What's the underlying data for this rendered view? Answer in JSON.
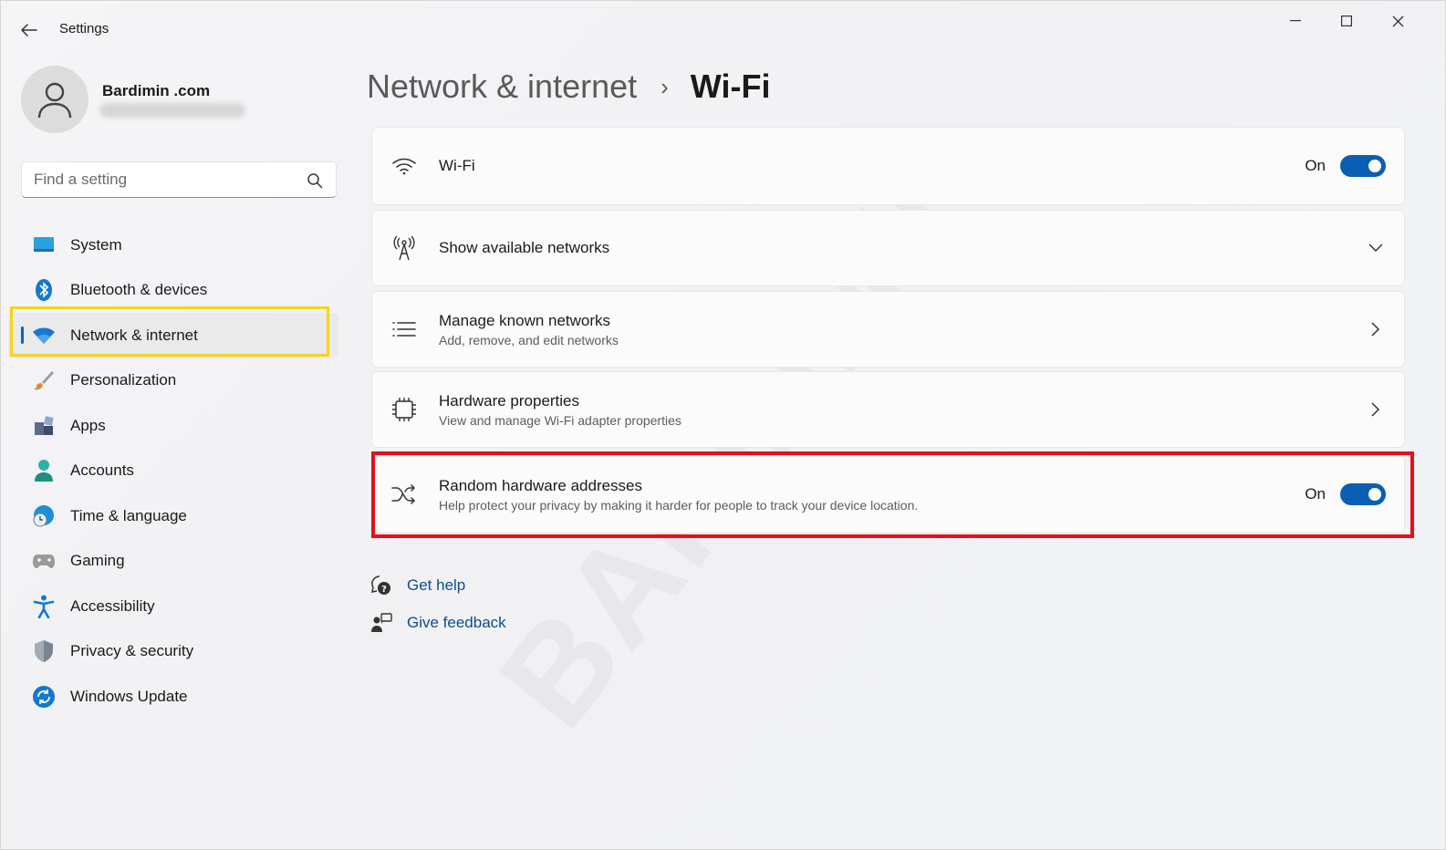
{
  "app": {
    "title": "Settings"
  },
  "window_controls": {
    "minimize": "minimize",
    "maximize": "maximize",
    "close": "close"
  },
  "profile": {
    "name": "Bardimin .com"
  },
  "search": {
    "placeholder": "Find a setting"
  },
  "sidebar": {
    "items": [
      {
        "label": "System",
        "icon": "system-icon",
        "color": "#2b9fe0"
      },
      {
        "label": "Bluetooth & devices",
        "icon": "bluetooth-icon",
        "color": "#1677d1"
      },
      {
        "label": "Network & internet",
        "icon": "wifi-icon",
        "color": "#1677d1",
        "active": true
      },
      {
        "label": "Personalization",
        "icon": "brush-icon",
        "color": "#e08a3a"
      },
      {
        "label": "Apps",
        "icon": "apps-icon",
        "color": "#5a6b8c"
      },
      {
        "label": "Accounts",
        "icon": "accounts-icon",
        "color": "#2fb3a0"
      },
      {
        "label": "Time & language",
        "icon": "globe-clock-icon",
        "color": "#1f8fd6"
      },
      {
        "label": "Gaming",
        "icon": "gamepad-icon",
        "color": "#8a8a8a"
      },
      {
        "label": "Accessibility",
        "icon": "accessibility-icon",
        "color": "#1677d1"
      },
      {
        "label": "Privacy & security",
        "icon": "shield-icon",
        "color": "#7a8390"
      },
      {
        "label": "Windows Update",
        "icon": "update-icon",
        "color": "#1677d1"
      }
    ]
  },
  "breadcrumb": {
    "parent": "Network & internet",
    "separator": "›",
    "current": "Wi-Fi"
  },
  "cards": {
    "wifi": {
      "title": "Wi-Fi",
      "state": "On",
      "icon": "wifi-icon"
    },
    "available": {
      "title": "Show available networks",
      "icon": "antenna-icon"
    },
    "known": {
      "title": "Manage known networks",
      "subtitle": "Add, remove, and edit networks",
      "icon": "list-icon"
    },
    "hardware": {
      "title": "Hardware properties",
      "subtitle": "View and manage Wi-Fi adapter properties",
      "icon": "chip-icon"
    },
    "random": {
      "title": "Random hardware addresses",
      "subtitle": "Help protect your privacy by making it harder for people to track your device location.",
      "state": "On",
      "icon": "shuffle-icon"
    }
  },
  "links": {
    "help": {
      "label": "Get help",
      "icon": "help-icon"
    },
    "feedback": {
      "label": "Give feedback",
      "icon": "feedback-icon"
    }
  },
  "colors": {
    "accent": "#0a5fb4",
    "link": "#0a4d8c",
    "highlight_yellow": "#f5d31c",
    "highlight_red": "#e4101b"
  },
  "watermark": "BARDIMIN"
}
